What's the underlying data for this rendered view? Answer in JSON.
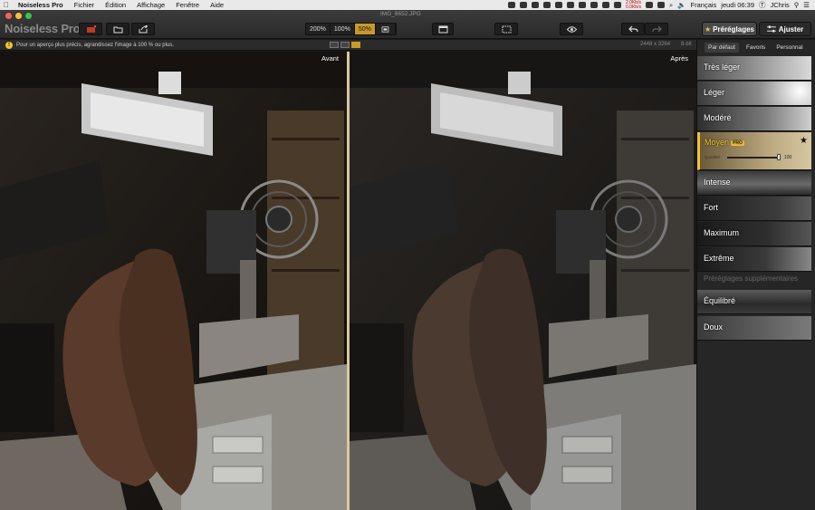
{
  "menubar": {
    "app": "Noiseless Pro",
    "menus": [
      "Fichier",
      "Édition",
      "Affichage",
      "Fenêtre",
      "Aide"
    ],
    "net_up": "2.0Kb/s",
    "net_down": "0.0Kb/s",
    "keyboard": "Français",
    "clock": "jeudi 06:39",
    "user": "JChris"
  },
  "toolbar": {
    "app_title": "Noiseless Pro",
    "file_name": "IMG_8652.JPG",
    "zoom": [
      "200%",
      "100%",
      "50%"
    ],
    "zoom_active": "50%",
    "presets_label": "Préréglages",
    "adjust_label": "Ajuster"
  },
  "infobar": {
    "message": "Pour un aperçu plus précis, agrandissez l'image à 100 % ou plus.",
    "dimensions": "2448 x 3264",
    "bit_depth": "8-bit"
  },
  "panes": {
    "before_label": "Avant",
    "after_label": "Après"
  },
  "sidebar": {
    "tabs": [
      "Par défaut",
      "Favoris",
      "Personnal"
    ],
    "active_tab": "Par défaut",
    "presets": [
      "Très léger",
      "Léger",
      "Modéré",
      "Moyen",
      "Intense",
      "Fort",
      "Maximum",
      "Extrême"
    ],
    "selected_preset": "Moyen",
    "pro_badge": "PRO",
    "quantity_label": "Quantité",
    "quantity_value": "100",
    "quantity_fraction": 1.0,
    "extra_title": "Préréglages supplémentaires",
    "extra_presets": [
      "Équilibré",
      "Doux"
    ]
  },
  "colors": {
    "accent": "#f3c331",
    "active_zoom": "#c89a2a"
  }
}
